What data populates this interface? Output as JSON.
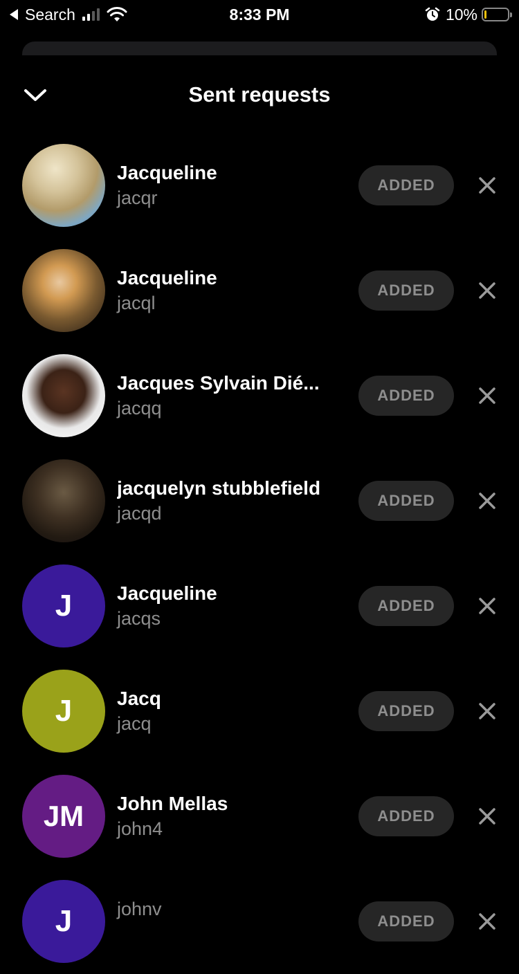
{
  "status_bar": {
    "back_app": "Search",
    "time": "8:33 PM",
    "battery_percent": "10%",
    "battery_level": 0.1,
    "battery_color": "#f4c20d"
  },
  "header": {
    "title": "Sent requests",
    "back_icon": "chevron-down-icon"
  },
  "requests": [
    {
      "name": "Jacqueline",
      "username": "jacqr",
      "avatar_type": "photo",
      "avatar_style": "photo-blonde",
      "button": "ADDED"
    },
    {
      "name": "Jacqueline",
      "username": "jacql",
      "avatar_type": "photo",
      "avatar_style": "photo-cat",
      "button": "ADDED"
    },
    {
      "name": "Jacques Sylvain Dié...",
      "username": "jacqq",
      "avatar_type": "photo",
      "avatar_style": "photo-man",
      "button": "ADDED"
    },
    {
      "name": "jacquelyn stubblefield",
      "username": "jacqd",
      "avatar_type": "photo",
      "avatar_style": "photo-dark",
      "button": "ADDED"
    },
    {
      "name": "Jacqueline",
      "username": "jacqs",
      "avatar_type": "initials",
      "initials": "J",
      "avatar_color": "#3a1a9a",
      "button": "ADDED"
    },
    {
      "name": "Jacq",
      "username": "jacq",
      "avatar_type": "initials",
      "initials": "J",
      "avatar_color": "#9aa21a",
      "button": "ADDED"
    },
    {
      "name": "John Mellas",
      "username": "john4",
      "avatar_type": "initials",
      "initials": "JM",
      "avatar_color": "#641c84",
      "button": "ADDED"
    },
    {
      "name": "",
      "username": "johnv",
      "avatar_type": "initials",
      "initials": "J",
      "avatar_color": "#3a1a9a",
      "button": "ADDED"
    }
  ]
}
